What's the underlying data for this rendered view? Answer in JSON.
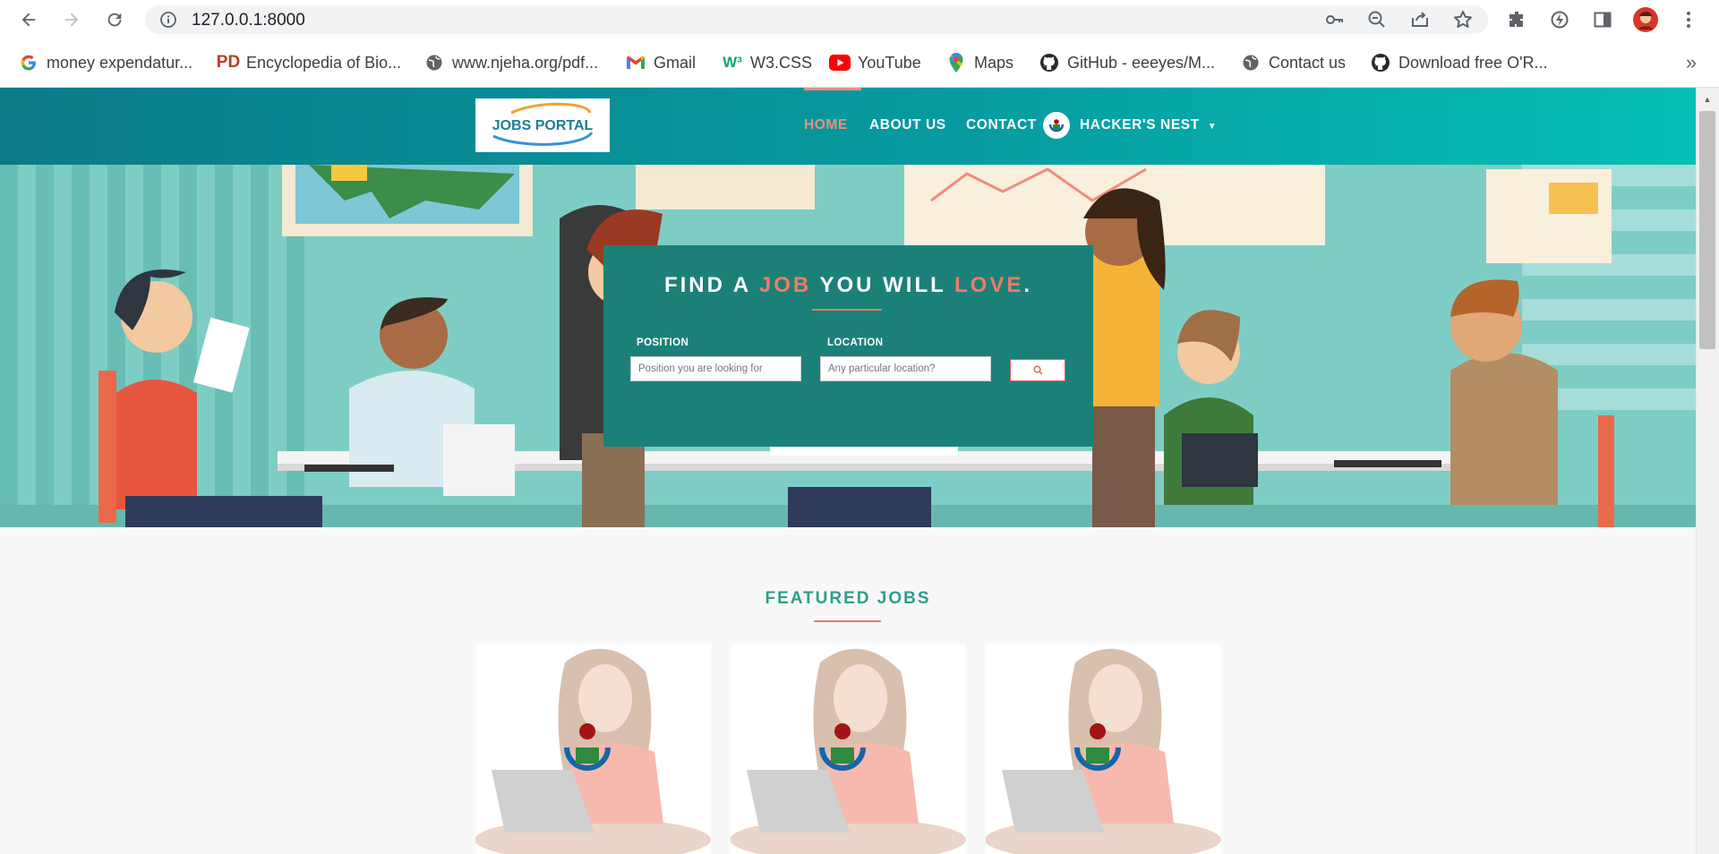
{
  "browser": {
    "url": "127.0.0.1:8000",
    "bookmarks": [
      {
        "label": "money expendatur...",
        "icon": "google-icon"
      },
      {
        "label": "Encyclopedia of Bio...",
        "icon": "pd-icon"
      },
      {
        "label": "www.njeha.org/pdf...",
        "icon": "globe-icon"
      },
      {
        "label": "Gmail",
        "icon": "gmail-icon"
      },
      {
        "label": "W3.CSS",
        "icon": "w3-icon"
      },
      {
        "label": "YouTube",
        "icon": "youtube-icon"
      },
      {
        "label": "Maps",
        "icon": "maps-icon"
      },
      {
        "label": "GitHub - eeeyes/M...",
        "icon": "github-icon"
      },
      {
        "label": "Contact us",
        "icon": "globe-icon"
      },
      {
        "label": "Download free O'R...",
        "icon": "github-icon"
      }
    ]
  },
  "site": {
    "logo_text": "JOBS PORTAL",
    "nav": {
      "home": "HOME",
      "about": "ABOUT US",
      "contact": "CONTACT",
      "user": "HACKER'S NEST"
    },
    "hero": {
      "headline_1": "FIND A ",
      "headline_job": "JOB",
      "headline_2": " YOU WILL ",
      "headline_love": "LOVE",
      "headline_end": ".",
      "position_label": "POSITION",
      "position_placeholder": "Position you are looking for",
      "location_label": "LOCATION",
      "location_placeholder": "Any particular location?"
    },
    "featured_title": "FEATURED JOBS"
  },
  "colors": {
    "header_gradient_start": "#0b7b86",
    "header_gradient_end": "#05bfb5",
    "accent": "#ef7b69",
    "search_box": "#1b8178",
    "featured_title": "#2e9e8b"
  }
}
